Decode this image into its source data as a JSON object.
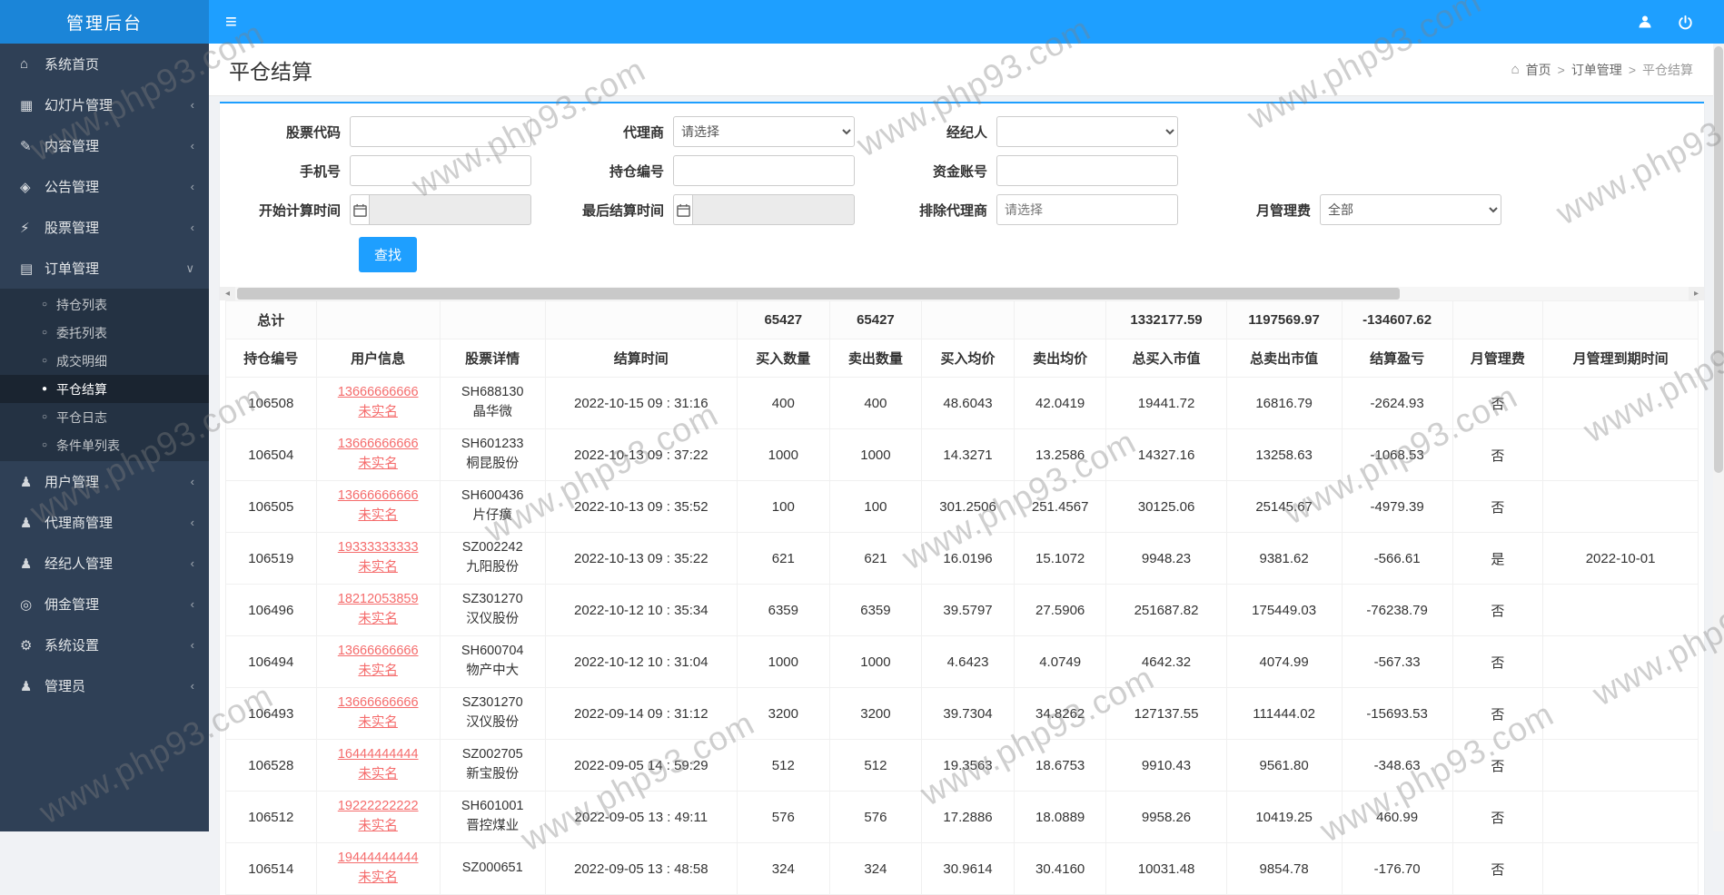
{
  "watermark": {
    "text": "www.php93.com"
  },
  "topbar": {
    "brand": "管理后台",
    "menu_icon": "≡"
  },
  "sidebar": {
    "icon_glyphs": {
      "home": "⌂",
      "slides": "▦",
      "edit": "✎",
      "announce": "◈",
      "stock": "⚡",
      "orders": "▤",
      "user": "♟",
      "money": "◎",
      "gear": "⚙",
      "admin": "♟"
    },
    "items": [
      {
        "key": "home",
        "label": "系统首页",
        "icon": "home",
        "arrow": ""
      },
      {
        "key": "slides",
        "label": "幻灯片管理",
        "icon": "slides",
        "arrow": "left"
      },
      {
        "key": "content",
        "label": "内容管理",
        "icon": "edit",
        "arrow": "left"
      },
      {
        "key": "notice",
        "label": "公告管理",
        "icon": "announce",
        "arrow": "left"
      },
      {
        "key": "stock",
        "label": "股票管理",
        "icon": "stock",
        "arrow": "left"
      },
      {
        "key": "orders",
        "label": "订单管理",
        "icon": "orders",
        "arrow": "down",
        "open": true,
        "children": [
          {
            "key": "position-list",
            "label": "持仓列表"
          },
          {
            "key": "entrust-list",
            "label": "委托列表"
          },
          {
            "key": "deal-detail",
            "label": "成交明细"
          },
          {
            "key": "close-settle",
            "label": "平仓结算",
            "active": true
          },
          {
            "key": "close-log",
            "label": "平仓日志"
          },
          {
            "key": "condition-list",
            "label": "条件单列表"
          }
        ]
      },
      {
        "key": "users",
        "label": "用户管理",
        "icon": "user",
        "arrow": "left"
      },
      {
        "key": "agents",
        "label": "代理商管理",
        "icon": "user",
        "arrow": "left"
      },
      {
        "key": "brokers",
        "label": "经纪人管理",
        "icon": "user",
        "arrow": "left"
      },
      {
        "key": "commission",
        "label": "佣金管理",
        "icon": "money",
        "arrow": "left"
      },
      {
        "key": "settings",
        "label": "系统设置",
        "icon": "gear",
        "arrow": "left"
      },
      {
        "key": "admins",
        "label": "管理员",
        "icon": "admin",
        "arrow": "left"
      }
    ]
  },
  "page": {
    "title": "平仓结算",
    "breadcrumb": {
      "home_icon": "⌂",
      "home": "首页",
      "sep": ">",
      "section": "订单管理",
      "current": "平仓结算"
    }
  },
  "filters": {
    "stock_code_label": "股票代码",
    "agent_label": "代理商",
    "agent_value": "请选择",
    "broker_label": "经纪人",
    "broker_value": "",
    "phone_label": "手机号",
    "position_no_label": "持仓编号",
    "fund_account_label": "资金账号",
    "start_time_label": "开始计算时间",
    "end_time_label": "最后结算时间",
    "exclude_agent_label": "排除代理商",
    "exclude_agent_placeholder": "请选择",
    "monthly_fee_label": "月管理费",
    "monthly_fee_value": "全部",
    "search_button": "查找"
  },
  "scrollbar": {
    "left_arrow": "◂",
    "right_arrow": "▸"
  },
  "table": {
    "headers": [
      "持仓编号",
      "用户信息",
      "股票详情",
      "结算时间",
      "买入数量",
      "卖出数量",
      "买入均价",
      "卖出均价",
      "总买入市值",
      "总卖出市值",
      "结算盈亏",
      "月管理费",
      "月管理到期时间"
    ],
    "summary": {
      "label": "总计",
      "buy_qty": "65427",
      "sell_qty": "65427",
      "buy_value": "1332177.59",
      "sell_value": "1197569.97",
      "pnl": "-134607.62"
    },
    "rows": [
      {
        "id": "106508",
        "phone": "13666666666",
        "verify": "未实名",
        "stock_code": "SH688130",
        "stock_name": "晶华微",
        "time": "2022-10-15 09 : 31:16",
        "buy_qty": "400",
        "sell_qty": "400",
        "buy_avg": "48.6043",
        "sell_avg": "42.0419",
        "buy_value": "19441.72",
        "sell_value": "16816.79",
        "pnl": "-2624.93",
        "fee": "否",
        "fee_due": ""
      },
      {
        "id": "106504",
        "phone": "13666666666",
        "verify": "未实名",
        "stock_code": "SH601233",
        "stock_name": "桐昆股份",
        "time": "2022-10-13 09 : 37:22",
        "buy_qty": "1000",
        "sell_qty": "1000",
        "buy_avg": "14.3271",
        "sell_avg": "13.2586",
        "buy_value": "14327.16",
        "sell_value": "13258.63",
        "pnl": "-1068.53",
        "fee": "否",
        "fee_due": ""
      },
      {
        "id": "106505",
        "phone": "13666666666",
        "verify": "未实名",
        "stock_code": "SH600436",
        "stock_name": "片仔癀",
        "time": "2022-10-13 09 : 35:52",
        "buy_qty": "100",
        "sell_qty": "100",
        "buy_avg": "301.2506",
        "sell_avg": "251.4567",
        "buy_value": "30125.06",
        "sell_value": "25145.67",
        "pnl": "-4979.39",
        "fee": "否",
        "fee_due": ""
      },
      {
        "id": "106519",
        "phone": "19333333333",
        "verify": "未实名",
        "stock_code": "SZ002242",
        "stock_name": "九阳股份",
        "time": "2022-10-13 09 : 35:22",
        "buy_qty": "621",
        "sell_qty": "621",
        "buy_avg": "16.0196",
        "sell_avg": "15.1072",
        "buy_value": "9948.23",
        "sell_value": "9381.62",
        "pnl": "-566.61",
        "fee": "是",
        "fee_due": "2022-10-01"
      },
      {
        "id": "106496",
        "phone": "18212053859",
        "verify": "未实名",
        "stock_code": "SZ301270",
        "stock_name": "汉仪股份",
        "time": "2022-10-12 10 : 35:34",
        "buy_qty": "6359",
        "sell_qty": "6359",
        "buy_avg": "39.5797",
        "sell_avg": "27.5906",
        "buy_value": "251687.82",
        "sell_value": "175449.03",
        "pnl": "-76238.79",
        "fee": "否",
        "fee_due": ""
      },
      {
        "id": "106494",
        "phone": "13666666666",
        "verify": "未实名",
        "stock_code": "SH600704",
        "stock_name": "物产中大",
        "time": "2022-10-12 10 : 31:04",
        "buy_qty": "1000",
        "sell_qty": "1000",
        "buy_avg": "4.6423",
        "sell_avg": "4.0749",
        "buy_value": "4642.32",
        "sell_value": "4074.99",
        "pnl": "-567.33",
        "fee": "否",
        "fee_due": ""
      },
      {
        "id": "106493",
        "phone": "13666666666",
        "verify": "未实名",
        "stock_code": "SZ301270",
        "stock_name": "汉仪股份",
        "time": "2022-09-14 09 : 31:12",
        "buy_qty": "3200",
        "sell_qty": "3200",
        "buy_avg": "39.7304",
        "sell_avg": "34.8262",
        "buy_value": "127137.55",
        "sell_value": "111444.02",
        "pnl": "-15693.53",
        "fee": "否",
        "fee_due": ""
      },
      {
        "id": "106528",
        "phone": "16444444444",
        "verify": "未实名",
        "stock_code": "SZ002705",
        "stock_name": "新宝股份",
        "time": "2022-09-05 14 : 59:29",
        "buy_qty": "512",
        "sell_qty": "512",
        "buy_avg": "19.3563",
        "sell_avg": "18.6753",
        "buy_value": "9910.43",
        "sell_value": "9561.80",
        "pnl": "-348.63",
        "fee": "否",
        "fee_due": ""
      },
      {
        "id": "106512",
        "phone": "19222222222",
        "verify": "未实名",
        "stock_code": "SH601001",
        "stock_name": "晋控煤业",
        "time": "2022-09-05 13 : 49:11",
        "buy_qty": "576",
        "sell_qty": "576",
        "buy_avg": "17.2886",
        "sell_avg": "18.0889",
        "buy_value": "9958.26",
        "sell_value": "10419.25",
        "pnl": "460.99",
        "fee": "否",
        "fee_due": ""
      },
      {
        "id": "106514",
        "phone": "19444444444",
        "verify": "未实名",
        "stock_code": "SZ000651",
        "stock_name": "",
        "time": "2022-09-05 13 : 48:58",
        "buy_qty": "324",
        "sell_qty": "324",
        "buy_avg": "30.9614",
        "sell_avg": "30.4160",
        "buy_value": "10031.48",
        "sell_value": "9854.78",
        "pnl": "-176.70",
        "fee": "否",
        "fee_due": ""
      }
    ]
  },
  "colors": {
    "accent": "#1e9fff",
    "sidebar_bg": "#2f4056",
    "link_red": "#f56c6c"
  }
}
